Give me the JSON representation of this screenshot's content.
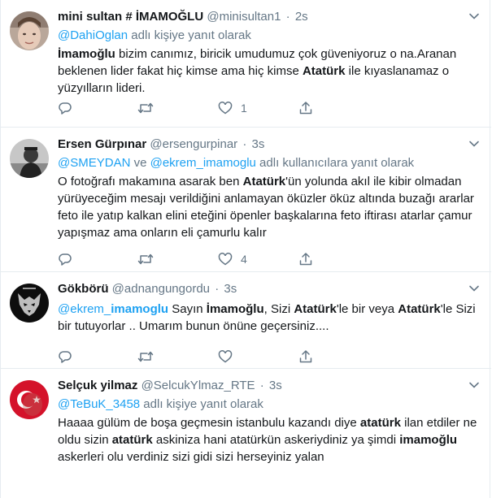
{
  "tweets": [
    {
      "name": "mini sultan # İMAMOĞLU",
      "handle": "@minisultan1",
      "dot": "·",
      "time": "2s",
      "reply_prefix": "",
      "reply_mention": "@DahiOglan",
      "reply_suffix": " adlı kişiye yanıt olarak",
      "text_parts": [
        {
          "t": "İmamoğlu",
          "b": true
        },
        {
          "t": " bizim canımız, biricik umudumuz çok güveniyoruz o na.Aranan beklenen lider fakat hiç kimse ama hiç kimse ",
          "b": false
        },
        {
          "t": "Atatürk",
          "b": true
        },
        {
          "t": " ile kıyaslanamaz o yüzyılların lideri.",
          "b": false
        }
      ],
      "like_count": "1",
      "retweet_count": ""
    },
    {
      "name": "Ersen Gürpınar",
      "handle": "@ersengurpinar",
      "dot": "·",
      "time": "3s",
      "reply_mention": "@SMEYDAN",
      "reply_mid": " ve ",
      "reply_mention2": "@ekrem_imamoglu",
      "reply_suffix": " adlı kullanıcılara yanıt olarak",
      "text_parts": [
        {
          "t": "O fotoğrafı makamına asarak ben ",
          "b": false
        },
        {
          "t": "Atatürk",
          "b": true
        },
        {
          "t": "'ün yolunda akıl ile kibir olmadan yürüyeceğim mesajı verildiğini anlamayan öküzler öküz altında buzağı ararlar feto ile yatıp kalkan elini eteğini öpenler başkalarına feto iftirası atarlar çamur yapışmaz ama onların eli çamurlu kalır",
          "b": false
        }
      ],
      "like_count": "4",
      "retweet_count": ""
    },
    {
      "name": "Gökbörü",
      "handle": "@adnangungordu",
      "dot": "·",
      "time": "3s",
      "text_parts": [
        {
          "t": "@ekrem_",
          "b": false,
          "m": true
        },
        {
          "t": "imamoglu",
          "b": true,
          "m": true
        },
        {
          "t": " Sayın ",
          "b": false
        },
        {
          "t": "İmamoğlu",
          "b": true
        },
        {
          "t": ", Sizi ",
          "b": false
        },
        {
          "t": "Atatürk",
          "b": true
        },
        {
          "t": "'le bir veya ",
          "b": false
        },
        {
          "t": "Atatürk",
          "b": true
        },
        {
          "t": "'le Sizi bir tutuyorlar .. Umarım bunun önüne geçersiniz....",
          "b": false
        }
      ],
      "like_count": "",
      "retweet_count": ""
    },
    {
      "name": "Selçuk yilmaz",
      "handle": "@SelcukYlmaz_RTE",
      "dot": "·",
      "time": "3s",
      "reply_mention": "@TeBuK_3458",
      "reply_suffix": " adlı kişiye yanıt olarak",
      "text_parts": [
        {
          "t": "Haaaa gülüm de boşa geçmesin istanbulu kazandı diye ",
          "b": false
        },
        {
          "t": "atatürk",
          "b": true
        },
        {
          "t": " ilan etdiler ne oldu sizin ",
          "b": false
        },
        {
          "t": "atatürk",
          "b": true
        },
        {
          "t": " askiniza hani  atatürkün askeriydiniz ya şimdi ",
          "b": false
        },
        {
          "t": "imamoğlu",
          "b": true
        },
        {
          "t": " askerleri olu verdiniz sizi gidi sizi herseyiniz yalan",
          "b": false
        }
      ],
      "like_count": "",
      "retweet_count": ""
    }
  ],
  "icons": {
    "reply": "reply-icon",
    "retweet": "retweet-icon",
    "like": "heart-icon",
    "share": "share-icon",
    "caret": "chevron-down-icon"
  },
  "colors": {
    "link": "#1da1f2",
    "secondary": "#657786",
    "text": "#14171a",
    "border": "#e6ecf0"
  }
}
